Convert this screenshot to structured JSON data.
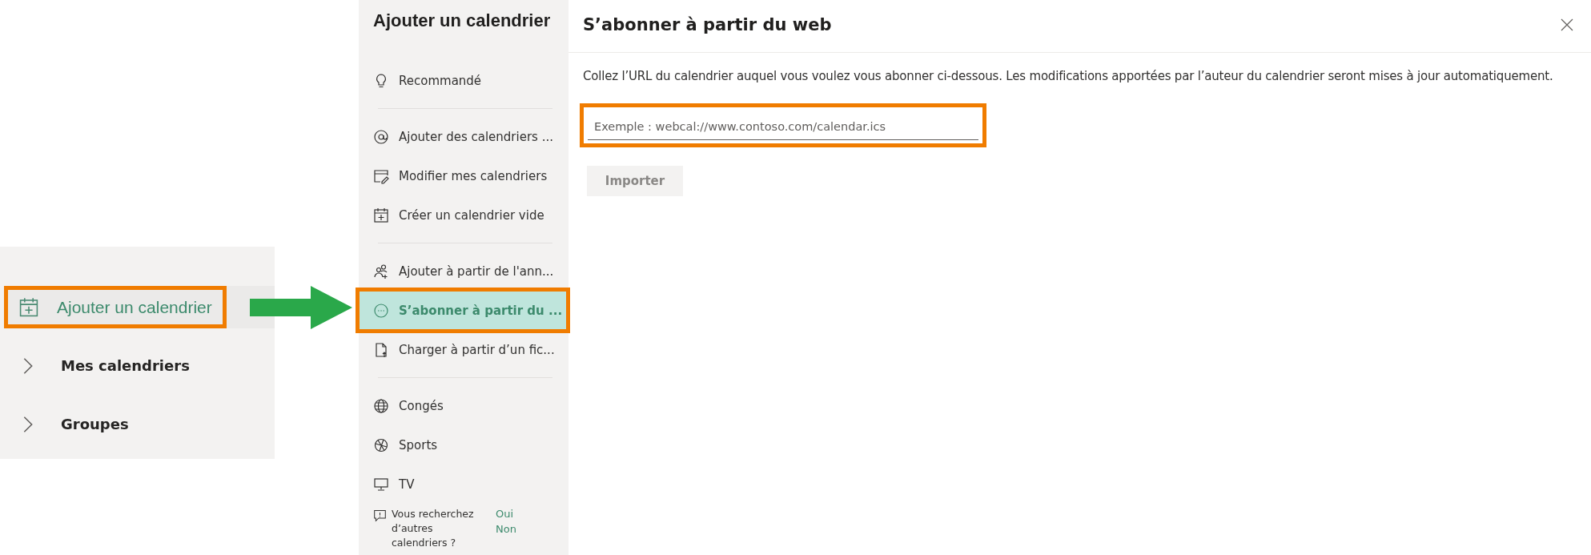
{
  "sidebar": {
    "items": [
      {
        "kind": "action",
        "label": "Ajouter un calendrier",
        "selected": true,
        "highlighted": true
      },
      {
        "kind": "group",
        "label": "Mes calendriers",
        "expanded": false,
        "highlighted": false
      },
      {
        "kind": "group",
        "label": "Groupes",
        "expanded": false,
        "highlighted": false
      }
    ]
  },
  "dialog": {
    "nav": {
      "title": "Ajouter un calendrier",
      "sections": [
        [
          {
            "label": "Recommandé",
            "selected": false,
            "highlighted": false
          }
        ],
        [
          {
            "label": "Ajouter des calendriers ...",
            "selected": false,
            "highlighted": false
          },
          {
            "label": "Modifier mes calendriers",
            "selected": false,
            "highlighted": false
          },
          {
            "label": "Créer un calendrier vide",
            "selected": false,
            "highlighted": false
          }
        ],
        [
          {
            "label": "Ajouter à partir de l'ann...",
            "selected": false,
            "highlighted": false
          },
          {
            "label": "S’abonner à partir du ...",
            "selected": true,
            "highlighted": true
          },
          {
            "label": "Charger à partir d’un fic...",
            "selected": false,
            "highlighted": false
          }
        ],
        [
          {
            "label": "Congés",
            "selected": false,
            "highlighted": false
          },
          {
            "label": "Sports",
            "selected": false,
            "highlighted": false
          },
          {
            "label": "TV",
            "selected": false,
            "highlighted": false
          }
        ]
      ],
      "feedback": {
        "text": "Vous recherchez d’autres calendriers ?",
        "yes": "Oui",
        "no": "Non"
      }
    },
    "panel": {
      "title": "S’abonner à partir du web",
      "description": "Collez l’URL du calendrier auquel vous voulez vous abonner ci-dessous. Les modifications apportées par l’auteur du calendrier seront mises à jour automatiquement.",
      "url_field": {
        "placeholder": "Exemple : webcal://www.contoso.com/calendar.ics",
        "highlighted": true
      },
      "import_button": {
        "label": "Importer",
        "disabled": true
      }
    }
  }
}
